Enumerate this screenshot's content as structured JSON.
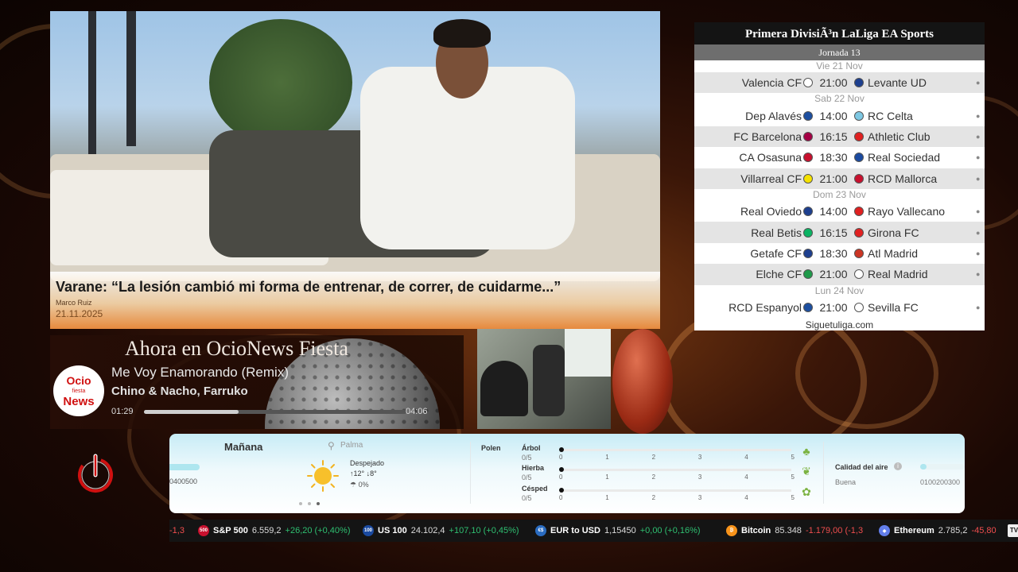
{
  "news": {
    "title": "Varane: “La lesión cambió mi forma de entrenar, de correr, de cuidarme...”",
    "author": "Marco Ruiz",
    "date": "21.11.2025"
  },
  "laliga": {
    "title": "Primera DivisiÃ³n LaLiga EA Sports",
    "round": "Jornada 13",
    "days": [
      {
        "label": "Vie 21 Nov",
        "matches": [
          {
            "home": "Valencia CF",
            "time": "21:00",
            "away": "Levante UD",
            "home_color": "#ffffff",
            "away_color": "#1d3f8f"
          }
        ]
      },
      {
        "label": "Sab 22 Nov",
        "matches": [
          {
            "home": "Dep Alavés",
            "time": "14:00",
            "away": "RC Celta",
            "home_color": "#1d4fa0",
            "away_color": "#7ec8e3"
          },
          {
            "home": "FC Barcelona",
            "time": "16:15",
            "away": "Athletic Club",
            "home_color": "#a50044",
            "away_color": "#e02020"
          },
          {
            "home": "CA Osasuna",
            "time": "18:30",
            "away": "Real Sociedad",
            "home_color": "#c8102e",
            "away_color": "#1a4aa0"
          },
          {
            "home": "Villarreal CF",
            "time": "21:00",
            "away": "RCD Mallorca",
            "home_color": "#f5e200",
            "away_color": "#c8102e"
          }
        ]
      },
      {
        "label": "Dom 23 Nov",
        "matches": [
          {
            "home": "Real Oviedo",
            "time": "14:00",
            "away": "Rayo Vallecano",
            "home_color": "#1d3f8f",
            "away_color": "#e02020"
          },
          {
            "home": "Real Betis",
            "time": "16:15",
            "away": "Girona FC",
            "home_color": "#0bb363",
            "away_color": "#e02020"
          },
          {
            "home": "Getafe CF",
            "time": "18:30",
            "away": "Atl Madrid",
            "home_color": "#1d3f8f",
            "away_color": "#cb3524"
          },
          {
            "home": "Elche CF",
            "time": "21:00",
            "away": "Real Madrid",
            "home_color": "#1f9a4a",
            "away_color": "#ffffff"
          }
        ]
      },
      {
        "label": "Lun 24 Nov",
        "matches": [
          {
            "home": "RCD Espanyol",
            "time": "21:00",
            "away": "Sevilla FC",
            "home_color": "#1d4fa0",
            "away_color": "#ffffff"
          }
        ]
      }
    ],
    "footer": "Siguetuliga.com"
  },
  "now_playing": {
    "heading": "Ahora en OcioNews Fiesta",
    "logo_line1": "Ocio",
    "logo_line2": "fiesta",
    "logo_line3": "News",
    "song": "Me Voy Enamorando (Remix)",
    "artist": "Chino & Nacho, Farruko",
    "elapsed": "01:29",
    "duration": "04:06",
    "progress": 0.36
  },
  "weather": {
    "scale_left": "0400500",
    "day": "Mañana",
    "location": "Palma",
    "condition": "Despejado",
    "temps": "↑12°  ↓8°",
    "rain": "0%",
    "polen_label": "Polen",
    "pollen": [
      {
        "name": "Árbol",
        "value": "0/5"
      },
      {
        "name": "Hierba",
        "value": "0/5"
      },
      {
        "name": "Césped",
        "value": "0/5"
      }
    ],
    "pollen_ticks": [
      "0",
      "1",
      "2",
      "3",
      "4",
      "5"
    ],
    "air_quality_label": "Calidad del aire",
    "air_quality_status": "Buena",
    "air_quality_scale": "0100200300",
    "air_quality_level": 0.15,
    "page_dots": 3,
    "active_dot": 2
  },
  "ticker": [
    {
      "name": "",
      "value": "",
      "change": "-1,3",
      "dir": "dn",
      "icon": "",
      "color": "#444"
    },
    {
      "name": "S&P 500",
      "value": "6.559,2",
      "change": "+26,20 (+0,40%)",
      "dir": "up",
      "icon": "500",
      "color": "#c8102e"
    },
    {
      "name": "US 100",
      "value": "24.102,4",
      "change": "+107,10 (+0,45%)",
      "dir": "up",
      "icon": "100",
      "color": "#1a4aa0"
    },
    {
      "name": "EUR to USD",
      "value": "1,15450",
      "change": "+0,00 (+0,16%)",
      "dir": "up",
      "icon": "€$",
      "color": "#2a6cc0"
    },
    {
      "name": "Bitcoin",
      "value": "85.348",
      "change": "-1.179,00 (-1,3",
      "dir": "dn",
      "icon": "₿",
      "color": "#f7931a"
    },
    {
      "name": "Ethereum",
      "value": "2.785,2",
      "change": "-45,80",
      "dir": "dn",
      "icon": "◆",
      "color": "#627eea"
    }
  ],
  "ticker_logo": "TV",
  "colors": {
    "accent_orange": "#ee8c3c",
    "power_red": "#d01010",
    "ticker_up": "#2fbf71",
    "ticker_down": "#f04e4e"
  }
}
